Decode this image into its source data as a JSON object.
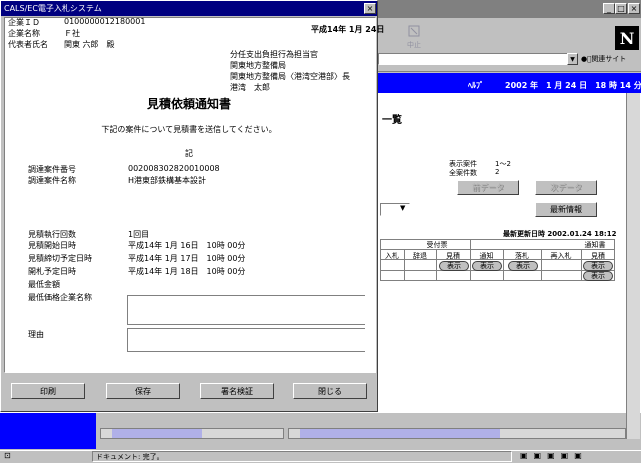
{
  "browser": {
    "win_buttons": [
      "_",
      "□",
      "×"
    ],
    "toolbar_stop": "中止",
    "logo": "N",
    "related_sites": "ﾞ関連サイト",
    "header_help": "ﾍﾙﾌﾟ",
    "header_datetime": "2002 年　1 月 24 日　18 時 14 分",
    "list_title": "一覧",
    "display_count_label": "表示案件",
    "display_count_value": "1～2",
    "total_count_label": "全案件数",
    "total_count_value": "2",
    "prev_button": "前データ",
    "next_button": "次データ",
    "refresh_button": "最新情報",
    "updated_label": "最新更新日時 2002.01.24 18:12",
    "table": {
      "group_receipt": "受付票",
      "group_notice": "通知書",
      "cols": [
        "入札",
        "辞退",
        "見積",
        "通知",
        "落札",
        "再入札",
        "見積"
      ],
      "show": "表示"
    },
    "status": "ドキュメント: 完了。"
  },
  "popup": {
    "title": "CALS/EC電子入札システム",
    "close": "×",
    "company_id_label": "企業ＩＤ",
    "company_id": "0100000012180001",
    "company_name_label": "企業名称",
    "company_name": "Ｆ社",
    "rep_label": "代表者氏名",
    "rep_name": "関東 六郎　殿",
    "date": "平成14年 1月 24日",
    "sender": [
      "分任支出負担行為担当官",
      "関東地方整備局",
      "関東地方整備局〈港湾空港部〉長",
      "港湾　太郎"
    ],
    "doc_title": "見積依頼通知書",
    "intro": "下記の案件について見積書を送信してください。",
    "ki": "記",
    "case_no_label": "調達案件番号",
    "case_no": "0020083028200100​08",
    "case_name_label": "調達案件名称",
    "case_name": "H港東部鉄構基本設計",
    "round_label": "見積執行回数",
    "round": "1回目",
    "start_label": "見積開始日時",
    "start": "平成14年 1月 16日　10時 00分",
    "deadline_label": "見積締切予定日時",
    "deadline": "平成14年 1月 17日　10時 00分",
    "open_label": "開札予定日時",
    "open": "平成14年 1月 18日　10時 00分",
    "min_label": "最低金額",
    "min_company_label": "最低価格企業名称",
    "reason_label": "理由",
    "buttons": [
      "印刷",
      "保存",
      "署名検証",
      "閉じる"
    ]
  }
}
